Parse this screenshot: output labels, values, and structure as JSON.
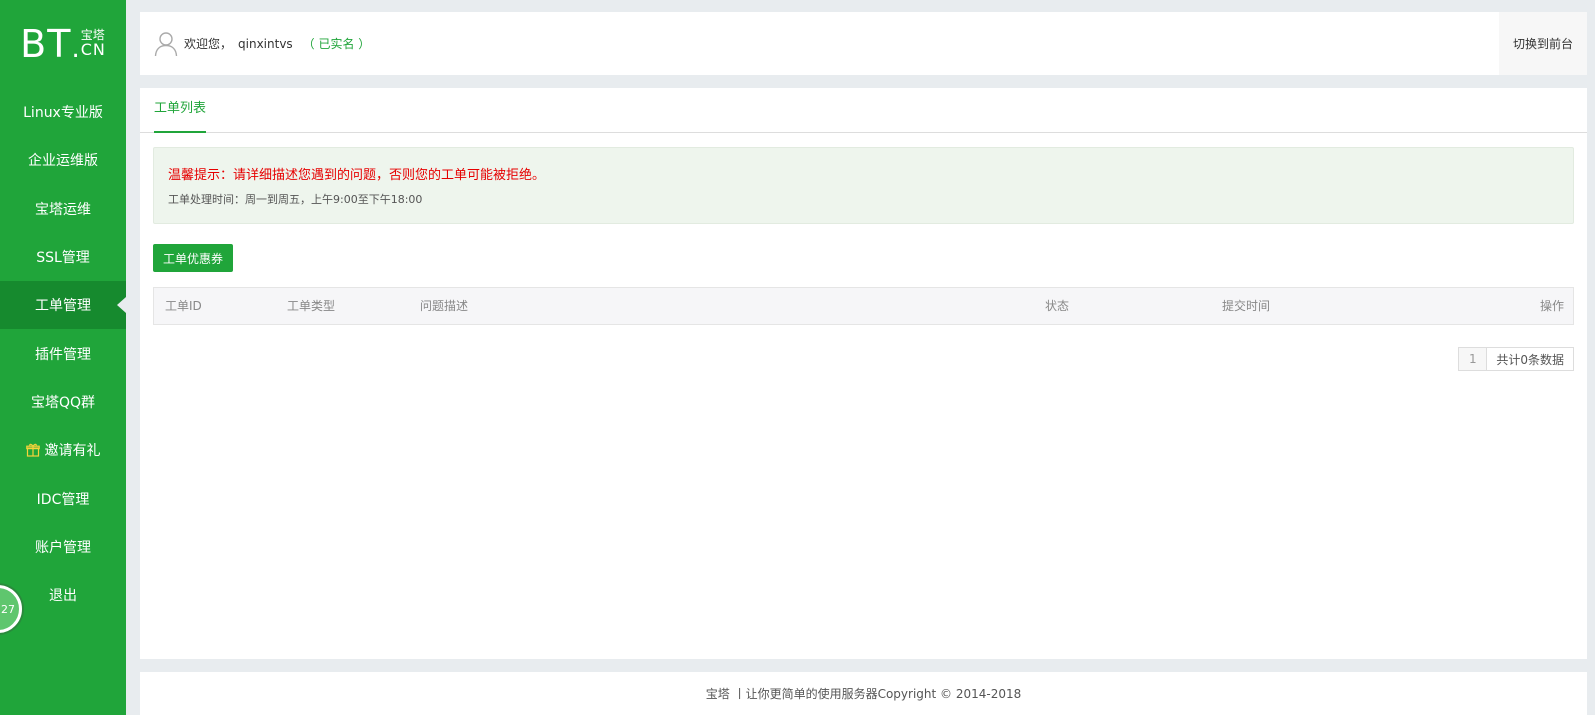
{
  "logo": {
    "bt": "BT",
    "dot": ".",
    "cn_top": "宝塔",
    "cn_bottom": "CN"
  },
  "sidebar": {
    "items": [
      {
        "label": "Linux专业版"
      },
      {
        "label": "企业运维版"
      },
      {
        "label": "宝塔运维"
      },
      {
        "label": "SSL管理"
      },
      {
        "label": "工单管理",
        "active": true
      },
      {
        "label": "插件管理"
      },
      {
        "label": "宝塔QQ群"
      },
      {
        "label": "邀请有礼",
        "icon": "gift-icon"
      },
      {
        "label": "IDC管理"
      },
      {
        "label": "账户管理"
      },
      {
        "label": "退出"
      }
    ],
    "badge": "27"
  },
  "header": {
    "welcome": "欢迎您，",
    "username": "qinxintvs",
    "verified": "（ 已实名 ）",
    "switch_label": "切换到前台"
  },
  "main": {
    "tab_label": "工单列表",
    "notice": {
      "warning": "温馨提示：请详细描述您遇到的问题，否则您的工单可能被拒绝。",
      "hours": "工单处理时间：周一到周五，上午9:00至下午18:00"
    },
    "coupon_button": "工单优惠券",
    "table": {
      "headers": [
        "工单ID",
        "工单类型",
        "问题描述",
        "状态",
        "提交时间",
        "操作"
      ]
    },
    "pager": {
      "page": "1",
      "total": "共计0条数据"
    }
  },
  "footer": {
    "text": "宝塔 丨让你更简单的使用服务器Copyright © 2014-2018"
  },
  "colors": {
    "brand": "#20a53a",
    "brand_dark": "#168a2e",
    "warning": "#e60000"
  }
}
